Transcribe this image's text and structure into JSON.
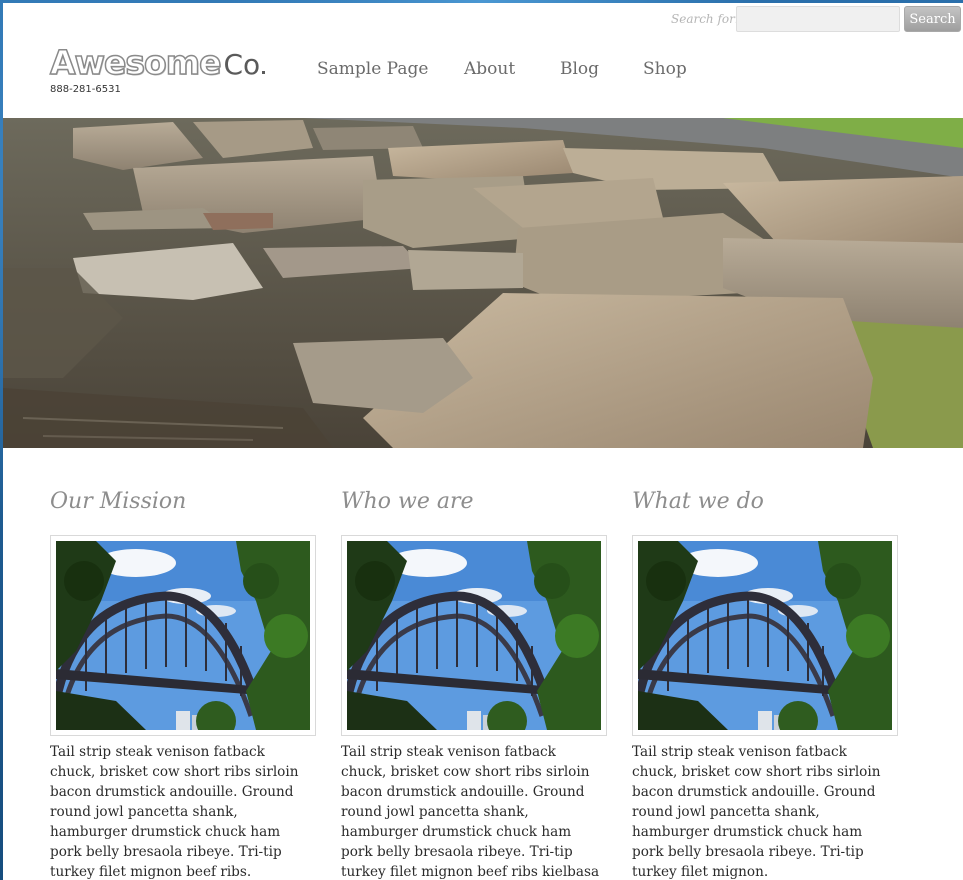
{
  "search": {
    "label": "Search for:",
    "placeholder": "",
    "button_label": "Search"
  },
  "logo": {
    "main": "Awesome",
    "co": "Co",
    "phone": "888-281-6531"
  },
  "nav": [
    {
      "label": "Sample Page"
    },
    {
      "label": "About"
    },
    {
      "label": "Blog"
    },
    {
      "label": "Shop"
    }
  ],
  "columns": [
    {
      "title": "Our Mission",
      "text": "Tail strip steak venison fatback chuck, brisket cow short ribs sirloin bacon drumstick andouille. Ground round jowl pancetta shank, hamburger drumstick chuck ham pork belly bresaola ribeye. Tri-tip turkey filet mignon beef ribs."
    },
    {
      "title": "Who we are",
      "text": "Tail strip steak venison fatback chuck, brisket cow short ribs sirloin bacon drumstick andouille. Ground round jowl pancetta shank, hamburger drumstick chuck ham pork belly bresaola ribeye. Tri-tip turkey filet mignon beef ribs kielbasa biltong pig"
    },
    {
      "title": "What we do",
      "text": "Tail strip steak venison fatback chuck, brisket cow short ribs sirloin bacon drumstick andouille. Ground round jowl pancetta shank, hamburger drumstick chuck ham pork belly bresaola ribeye. Tri-tip turkey filet mignon."
    }
  ],
  "colors": {
    "heading": "#8d8d8d",
    "nav": "#6b6b6b",
    "search_button": "#a9a9a9",
    "body_text": "#2b2b2b"
  }
}
